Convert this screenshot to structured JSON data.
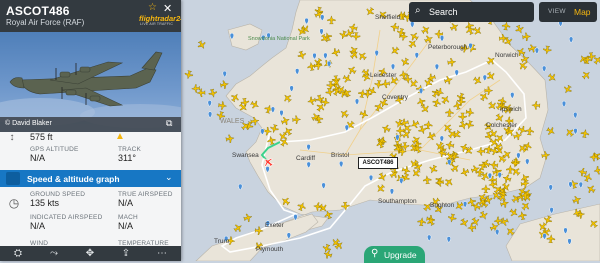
{
  "flight": {
    "callsign": "ASCOT486",
    "operator": "Royal Air Force (RAF)",
    "brand": "flightradar24",
    "brand_sub": "LIVE AIR TRAFFIC",
    "photo_credit": "© David Blaker",
    "map_label": "ASCOT486"
  },
  "details": {
    "altitude_value": "575 ft",
    "gps_altitude_label": "GPS ALTITUDE",
    "gps_altitude_value": "N/A",
    "track_label": "TRACK",
    "track_value": "311°",
    "speed_section_title": "Speed & altitude graph",
    "ground_speed_label": "GROUND SPEED",
    "ground_speed_value": "135 kts",
    "true_airspeed_label": "TRUE AIRSPEED",
    "true_airspeed_value": "N/A",
    "indicated_airspeed_label": "INDICATED AIRSPEED",
    "indicated_airspeed_value": "N/A",
    "mach_label": "MACH",
    "mach_value": "N/A",
    "wind_label": "WIND",
    "temperature_label": "TEMPERATURE"
  },
  "toolbar": {
    "search_label": "Search",
    "view_label": "VIEW",
    "view_mode": "Map",
    "upgrade_label": "Upgrade"
  },
  "map_places": [
    {
      "name": "Sheffield"
    },
    {
      "name": "Peterborough"
    },
    {
      "name": "Leicester"
    },
    {
      "name": "Coventry"
    },
    {
      "name": "WALES"
    },
    {
      "name": "Norwich"
    },
    {
      "name": "Ipswich"
    },
    {
      "name": "Colchester"
    },
    {
      "name": "Cardiff"
    },
    {
      "name": "Bristol"
    },
    {
      "name": "Southampton"
    },
    {
      "name": "Brighton"
    },
    {
      "name": "Swansea"
    },
    {
      "name": "Exeter"
    },
    {
      "name": "Plymouth"
    },
    {
      "name": "Truro"
    },
    {
      "name": "Snowdonia National Park"
    }
  ],
  "colors": {
    "accent": "#f5b60f",
    "panel_header": "#333a40",
    "speed_bar": "#1777c4",
    "upgrade": "#2aa676",
    "sea": "#c9d3df",
    "land": "#e9e4d9",
    "plane": "#f2c200",
    "track": "#ffffff",
    "track_recent": "#3ad28b"
  }
}
